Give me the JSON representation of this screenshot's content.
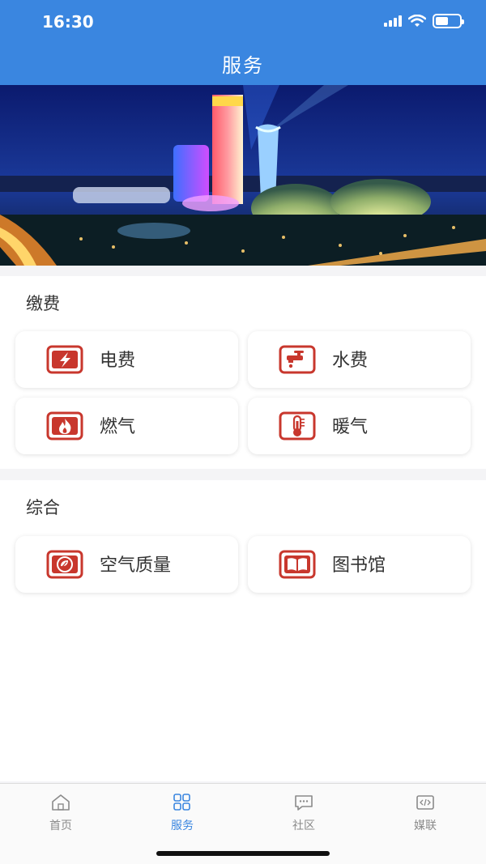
{
  "status": {
    "time": "16:30",
    "battery_level": 0.55
  },
  "header": {
    "title": "服务"
  },
  "banner": {
    "icon": "city-night-skyline-image"
  },
  "payment": {
    "title": "缴费",
    "items": [
      {
        "label": "电费",
        "icon": "electricity-icon"
      },
      {
        "label": "水费",
        "icon": "water-tap-icon"
      },
      {
        "label": "燃气",
        "icon": "gas-flame-icon"
      },
      {
        "label": "暖气",
        "icon": "thermometer-icon"
      }
    ]
  },
  "general": {
    "title": "综合",
    "items": [
      {
        "label": "空气质量",
        "icon": "air-quality-icon"
      },
      {
        "label": "图书馆",
        "icon": "library-book-icon"
      }
    ]
  },
  "tabbar": {
    "items": [
      {
        "label": "首页",
        "icon": "home-icon"
      },
      {
        "label": "服务",
        "icon": "grid-icon",
        "active": true
      },
      {
        "label": "社区",
        "icon": "chat-icon"
      },
      {
        "label": "媒联",
        "icon": "code-icon"
      }
    ]
  },
  "colors": {
    "primary": "#3a86e0",
    "icon_red": "#c8372d",
    "text": "#333333",
    "tab_inactive": "#8a8a8a"
  }
}
